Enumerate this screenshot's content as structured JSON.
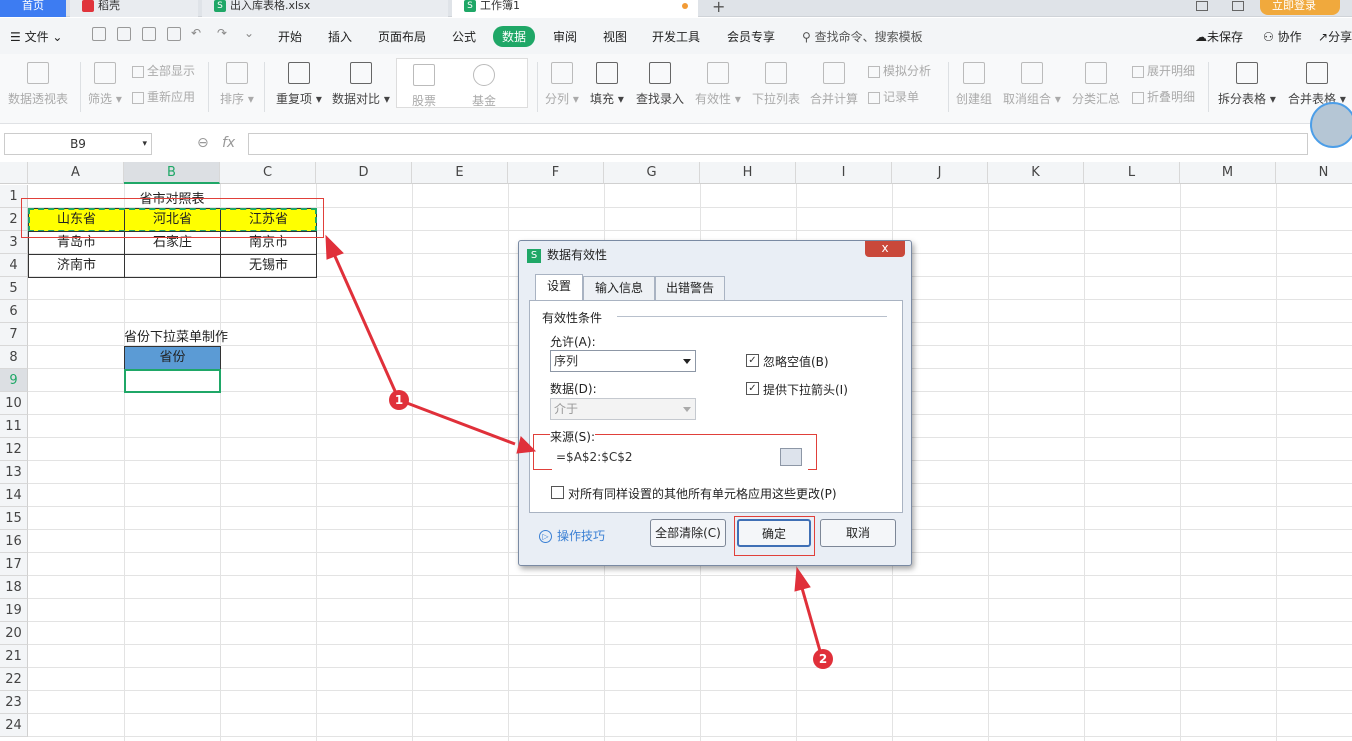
{
  "tabs": {
    "home": "首页",
    "tab1": "稻壳",
    "tab2": "出入库表格.xlsx",
    "tab3": "工作簿1",
    "login": "立即登录"
  },
  "menu": {
    "file": "文件",
    "items": [
      "开始",
      "插入",
      "页面布局",
      "公式",
      "数据",
      "审阅",
      "视图",
      "开发工具",
      "会员专享"
    ],
    "active": "数据",
    "search": "查找命令、搜索模板",
    "unsaved": "未保存",
    "collab": "协作",
    "share": "分享"
  },
  "ribbon": {
    "pivot": "数据透视表",
    "filter": "筛选",
    "show_all": "全部显示",
    "reapply": "重新应用",
    "sort": "排序",
    "duplicates": "重复项",
    "compare": "数据对比",
    "stock": "股票",
    "fund": "基金",
    "split": "分列",
    "fill": "填充",
    "lookup": "查找录入",
    "validity": "有效性",
    "dropdown": "下拉列表",
    "consolidate": "合并计算",
    "simulate": "模拟分析",
    "record": "记录单",
    "group": "创建组",
    "ungroup": "取消组合",
    "subtotal": "分类汇总",
    "expand": "展开明细",
    "collapse": "折叠明细",
    "split_table": "拆分表格",
    "merge_table": "合并表格"
  },
  "formula_bar": {
    "cell_ref": "B9",
    "fx": "fx",
    "formula": ""
  },
  "sheet": {
    "columns": [
      "A",
      "B",
      "C",
      "D",
      "E",
      "F",
      "G",
      "H",
      "I",
      "J",
      "K",
      "L",
      "M",
      "N"
    ],
    "selected_col": "B",
    "rows": [
      "1",
      "2",
      "3",
      "4",
      "5",
      "6",
      "7",
      "8",
      "9",
      "10",
      "11",
      "12",
      "13",
      "14",
      "15",
      "16",
      "17",
      "18",
      "19",
      "20",
      "21",
      "22",
      "23",
      "24"
    ],
    "selected_row": "9",
    "title": "省市对照表",
    "provinces": [
      "山东省",
      "河北省",
      "江苏省"
    ],
    "row3": [
      "青岛市",
      "石家庄",
      "南京市"
    ],
    "row4": [
      "济南市",
      "",
      "无锡市"
    ],
    "dropdown_title": "省份下拉菜单制作",
    "header": "省份",
    "highlight_color": "#ffff00",
    "header_color": "#5b9bd5"
  },
  "dialog": {
    "title": "数据有效性",
    "close": "x",
    "tabs": [
      "设置",
      "输入信息",
      "出错警告"
    ],
    "section": "有效性条件",
    "allow_label": "允许(A):",
    "allow_value": "序列",
    "ignore_blank": "忽略空值(B)",
    "data_label": "数据(D):",
    "data_value": "介于",
    "dropdown_arrow": "提供下拉箭头(I)",
    "source_label": "来源(S):",
    "source_value": "=$A$2:$C$2",
    "apply_all": "对所有同样设置的其他所有单元格应用这些更改(P)",
    "tips": "操作技巧",
    "clear_all": "全部清除(C)",
    "ok": "确定",
    "cancel": "取消"
  },
  "annotations": {
    "one": "1",
    "two": "2",
    "color": "#e0303a"
  }
}
